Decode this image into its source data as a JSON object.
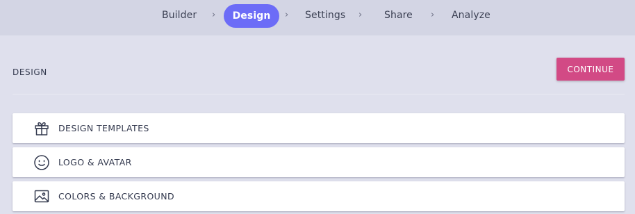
{
  "nav": {
    "steps": [
      {
        "label": "Builder"
      },
      {
        "label": "Design"
      },
      {
        "label": "Settings"
      },
      {
        "label": "Share"
      },
      {
        "label": "Analyze"
      }
    ],
    "active_step": "Design",
    "separator": "›"
  },
  "header": {
    "title": "DESIGN",
    "continue_label": "CONTINUE"
  },
  "sections": [
    {
      "label": "DESIGN TEMPLATES",
      "icon": "gift-icon"
    },
    {
      "label": "LOGO & AVATAR",
      "icon": "smiley-face-icon"
    },
    {
      "label": "COLORS & BACKGROUND",
      "icon": "image-icon"
    }
  ],
  "colors": {
    "accent": "#6c6cf7",
    "continue_button": "#d24a85",
    "page_background": "#dfe0ed",
    "nav_background": "#d3d5e4"
  }
}
